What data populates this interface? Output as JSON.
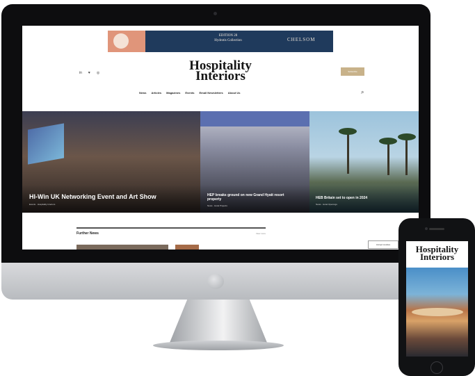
{
  "ad": {
    "edition_line1": "EDITION 28",
    "edition_line2": "Hydrotis Collection",
    "brand": "CHELSOM"
  },
  "header": {
    "social_icons": [
      "linkedin-icon",
      "twitter-icon",
      "instagram-icon"
    ],
    "social_labels": [
      "in",
      "♥",
      "◎"
    ],
    "logo_line1": "Hospitality",
    "logo_line2": "Interiors",
    "subscribe_label": "Subscribe"
  },
  "nav": {
    "items": [
      "News",
      "Articles",
      "Magazines",
      "Events",
      "Email Newsletters",
      "About Us"
    ]
  },
  "hero": {
    "tiles": [
      {
        "title": "HI-Win UK Networking Event and Art Show",
        "meta": "Events · Hospitality Interiors"
      },
      {
        "title": "HEP breaks ground on new Grand Hyatt resort property",
        "meta": "News · Hotel Projects"
      },
      {
        "title": "HEB Britain set to open in 2024",
        "meta": "News · Hotel Openings"
      }
    ]
  },
  "further_news": {
    "title": "Further News",
    "view_all": "View more"
  },
  "cookie": {
    "label": "Accept cookies"
  },
  "phone": {
    "logo_line1": "Hospitality",
    "logo_line2": "Interiors"
  },
  "colors": {
    "accent": "#c8b28a",
    "ad_background": "#1f3a5c",
    "device_bezel": "#0d0d0f"
  }
}
